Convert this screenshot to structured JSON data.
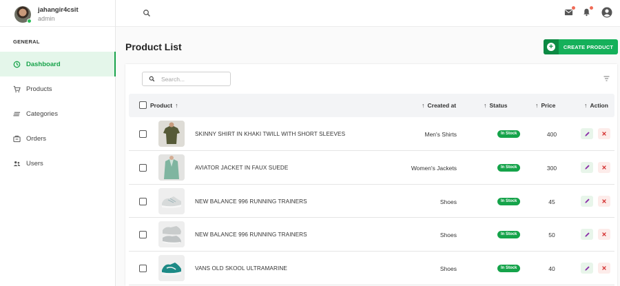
{
  "user": {
    "name": "jahangir4csit",
    "role": "admin"
  },
  "sidebar": {
    "section": "GENERAL",
    "items": [
      {
        "label": "Dashboard",
        "icon": "dashboard-icon",
        "active": true
      },
      {
        "label": "Products",
        "icon": "cart-icon",
        "active": false
      },
      {
        "label": "Categories",
        "icon": "categories-icon",
        "active": false
      },
      {
        "label": "Orders",
        "icon": "orders-icon",
        "active": false
      },
      {
        "label": "Users",
        "icon": "users-icon",
        "active": false
      }
    ]
  },
  "topbar": {
    "icons": [
      "search-icon",
      "mail-icon",
      "bell-icon",
      "account-icon"
    ]
  },
  "page": {
    "title": "Product List",
    "create_label": "CREATE PRODUCT"
  },
  "search": {
    "placeholder": "Search..."
  },
  "table": {
    "headers": {
      "product": "Product",
      "created": "Created at",
      "status": "Status",
      "price": "Price",
      "action": "Action"
    },
    "rows": [
      {
        "name": "SKINNY SHIRT IN KHAKI TWILL WITH SHORT SLEEVES",
        "category": "Men's Shirts",
        "status": "In Stock",
        "price": "400",
        "thumb": "shirt"
      },
      {
        "name": "AVIATOR JACKET IN FAUX SUEDE",
        "category": "Women's Jackets",
        "status": "In Stock",
        "price": "300",
        "thumb": "jacket"
      },
      {
        "name": "NEW BALANCE 996 RUNNING TRAINERS",
        "category": "Shoes",
        "status": "In Stock",
        "price": "45",
        "thumb": "shoe-grey"
      },
      {
        "name": "NEW BALANCE 996 RUNNING TRAINERS",
        "category": "Shoes",
        "status": "In Stock",
        "price": "50",
        "thumb": "shoe-grey2"
      },
      {
        "name": "VANS OLD SKOOL ULTRAMARINE",
        "category": "Shoes",
        "status": "In Stock",
        "price": "40",
        "thumb": "shoe-teal"
      }
    ]
  },
  "colors": {
    "accent": "#15b05a",
    "active_bg": "#e4f6ea",
    "badge": "#15a34a",
    "edit_bg": "#e8f5ea",
    "delete_bg": "#fdecea"
  }
}
